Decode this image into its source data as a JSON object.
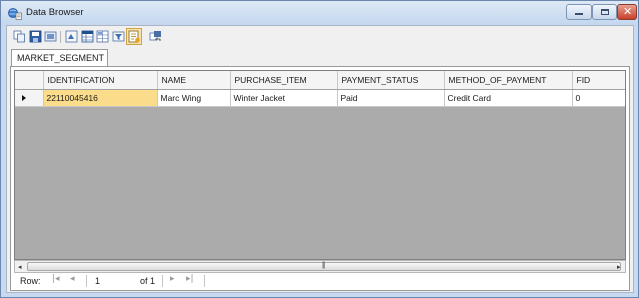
{
  "window": {
    "title": "Data Browser",
    "app_icon": "data-browser-icon",
    "controls": [
      "minimize-icon",
      "maximize-icon",
      "close-icon"
    ],
    "close_glyph": "✕"
  },
  "toolbar": {
    "icons": [
      "copy-icon",
      "save-icon",
      "save-as-icon",
      "refresh-icon",
      "table-view-icon",
      "grid-layout-icon",
      "filter-icon",
      "sql-query-icon",
      "export-icon"
    ],
    "pressed_icon": "sql-query-icon"
  },
  "tabs": [
    {
      "label": "MARKET_SEGMENT",
      "active": true
    }
  ],
  "grid": {
    "columns": [
      "IDENTIFICATION",
      "NAME",
      "PURCHASE_ITEM",
      "PAYMENT_STATUS",
      "METHOD_OF_PAYMENT",
      "FID"
    ],
    "rows": [
      [
        "22110045416",
        "Marc Wing",
        "Winter Jacket",
        "Paid",
        "Credit Card",
        "0"
      ]
    ],
    "current_row_indicator": "row-pointer-icon",
    "selected_cell": {
      "row": 0,
      "column": "IDENTIFICATION"
    },
    "colors": {
      "background": "#ababab",
      "selected_cell": "#fbdc8a",
      "header": "#f4f4f4"
    }
  },
  "scrollbar": {
    "left_arrow": "◂",
    "right_arrow": "▸",
    "grip": "|||"
  },
  "navigator": {
    "row_label": "Row:",
    "first": "|◂",
    "previous": "◂",
    "current": "1",
    "of_label": "of 1",
    "next": "▸",
    "last": "▸|"
  },
  "theme": {
    "titlebar": "#c4d7ee",
    "border": "#6b87ad",
    "close_button": "#c6402c"
  }
}
